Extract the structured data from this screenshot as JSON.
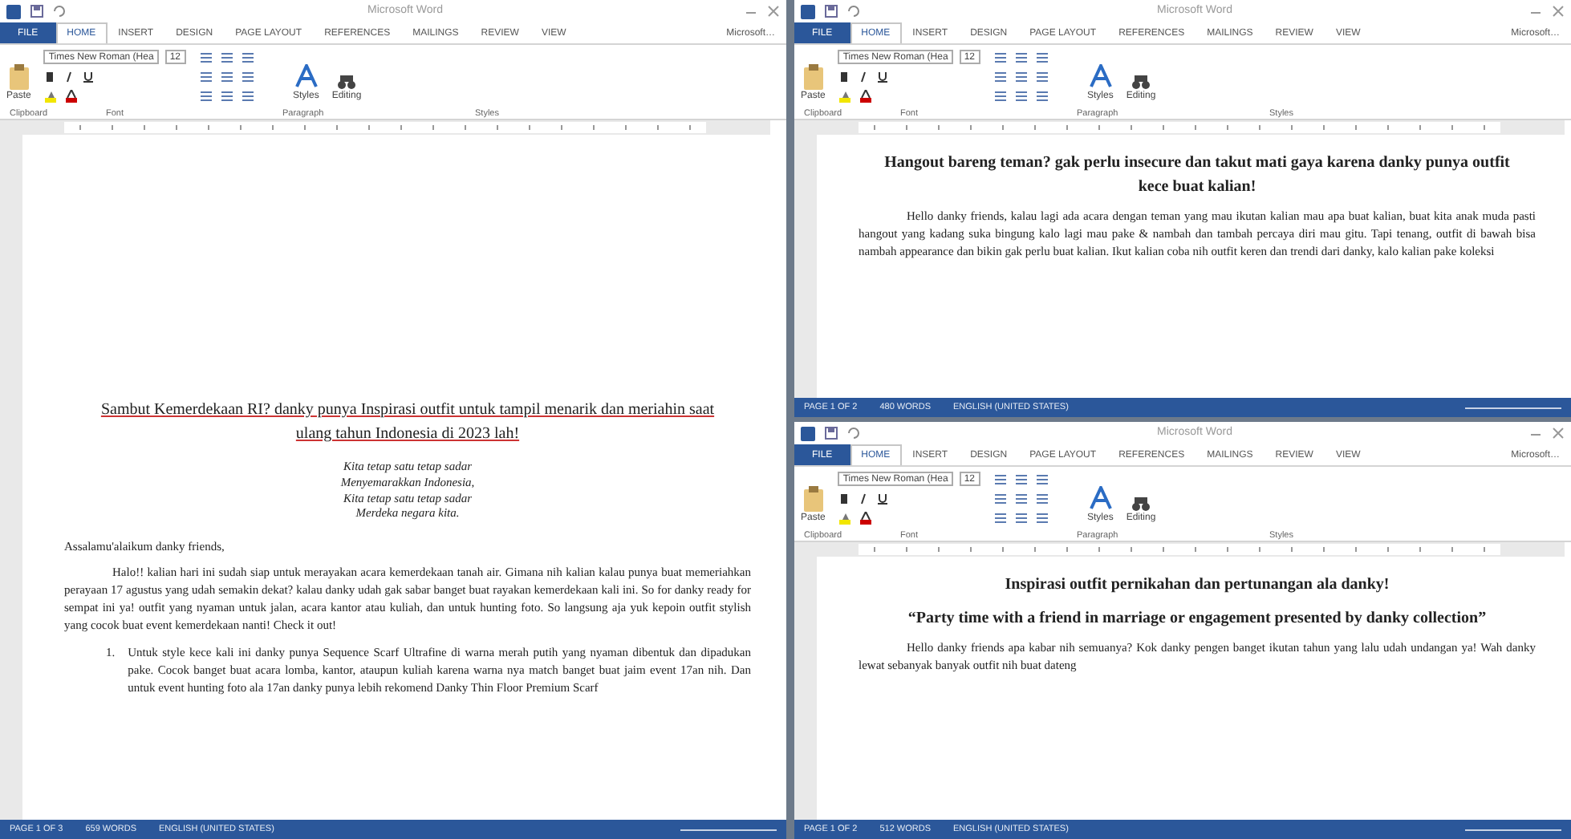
{
  "windows": [
    {
      "title": "Microsoft Word",
      "tabs": [
        {
          "label": "FILE",
          "kind": "file",
          "selected": false
        },
        {
          "label": "HOME",
          "kind": "tab",
          "selected": true
        },
        {
          "label": "INSERT",
          "kind": "tab",
          "selected": false
        },
        {
          "label": "DESIGN",
          "kind": "tab",
          "selected": false
        },
        {
          "label": "PAGE LAYOUT",
          "kind": "tab",
          "selected": false
        },
        {
          "label": "REFERENCES",
          "kind": "tab",
          "selected": false
        },
        {
          "label": "MAILINGS",
          "kind": "tab",
          "selected": false
        },
        {
          "label": "REVIEW",
          "kind": "tab",
          "selected": false
        },
        {
          "label": "VIEW",
          "kind": "tab",
          "selected": false
        },
        {
          "label": "Microsoft…",
          "kind": "account",
          "selected": false
        }
      ],
      "ribbon": {
        "font": "Times New Roman (Hea",
        "size": "12",
        "paste": "Paste",
        "styles": "Styles",
        "editing": "Editing",
        "groups": [
          "Clipboard",
          "Font",
          "Paragraph",
          "Styles"
        ]
      },
      "document": [
        {
          "kind": "heading",
          "text": "Sambut Kemerdekaan RI? danky punya Inspirasi outfit untuk tampil menarik dan meriahin saat ulang tahun Indonesia di 2023 lah!"
        },
        {
          "kind": "poem",
          "text": "Kita tetap satu tetap sadar"
        },
        {
          "kind": "poem",
          "text": "Menyemarakkan Indonesia,"
        },
        {
          "kind": "poem",
          "text": "Kita tetap satu tetap sadar"
        },
        {
          "kind": "poem",
          "text": "Merdeka negara kita."
        },
        {
          "kind": "greeting",
          "text": "Assalamu'alaikum danky friends,"
        },
        {
          "kind": "body",
          "text": "Halo!! kalian hari ini sudah siap untuk merayakan acara kemerdekaan tanah air. Gimana nih kalian kalau punya buat memeriahkan perayaan 17 agustus yang udah semakin dekat? kalau danky udah gak sabar banget buat rayakan kemerdekaan kali ini. So for danky ready for sempat ini ya! outfit yang nyaman untuk jalan, acara kantor atau kuliah, dan untuk hunting foto. So langsung aja yuk kepoin outfit stylish yang cocok buat event kemerdekaan nanti! Check it out!"
        },
        {
          "kind": "list",
          "number": "1.",
          "text": "Untuk style kece kali ini danky punya Sequence Scarf Ultrafine di warna merah putih yang nyaman dibentuk dan dipadukan pake. Cocok banget buat acara lomba, kantor, ataupun kuliah karena warna nya match banget buat jaim event 17an nih. Dan untuk event hunting foto ala 17an danky punya lebih rekomend Danky Thin Floor Premium Scarf"
        }
      ],
      "status": [
        "PAGE 1 OF 3",
        "659 WORDS",
        "ENGLISH (UNITED STATES)"
      ]
    },
    {
      "title": "Microsoft Word",
      "tabs": [
        {
          "label": "FILE",
          "kind": "file",
          "selected": false
        },
        {
          "label": "HOME",
          "kind": "tab",
          "selected": true
        },
        {
          "label": "INSERT",
          "kind": "tab",
          "selected": false
        },
        {
          "label": "DESIGN",
          "kind": "tab",
          "selected": false
        },
        {
          "label": "PAGE LAYOUT",
          "kind": "tab",
          "selected": false
        },
        {
          "label": "REFERENCES",
          "kind": "tab",
          "selected": false
        },
        {
          "label": "MAILINGS",
          "kind": "tab",
          "selected": false
        },
        {
          "label": "REVIEW",
          "kind": "tab",
          "selected": false
        },
        {
          "label": "VIEW",
          "kind": "tab",
          "selected": false
        },
        {
          "label": "Microsoft…",
          "kind": "account",
          "selected": false
        }
      ],
      "ribbon": {
        "font": "Times New Roman (Hea",
        "size": "12",
        "paste": "Paste",
        "styles": "Styles",
        "editing": "Editing",
        "groups": [
          "Clipboard",
          "Font",
          "Paragraph",
          "Styles"
        ]
      },
      "document": [
        {
          "kind": "title",
          "text": "Hangout bareng teman? gak perlu insecure dan takut mati gaya karena danky punya outfit kece buat kalian!"
        },
        {
          "kind": "body",
          "text": "Hello danky friends, kalau lagi ada acara dengan teman yang mau ikutan kalian mau apa buat kalian, buat kita anak muda pasti hangout yang kadang suka bingung kalo lagi mau pake & nambah dan tambah percaya diri mau gitu. Tapi tenang, outfit di bawah bisa nambah appearance dan bikin gak perlu buat kalian. Ikut kalian coba nih outfit keren dan trendi dari danky, kalo kalian pake koleksi"
        }
      ],
      "status": [
        "PAGE 1 OF 2",
        "480 WORDS",
        "ENGLISH (UNITED STATES)"
      ]
    },
    {
      "title": "Microsoft Word",
      "tabs": [
        {
          "label": "FILE",
          "kind": "file",
          "selected": false
        },
        {
          "label": "HOME",
          "kind": "tab",
          "selected": true
        },
        {
          "label": "INSERT",
          "kind": "tab",
          "selected": false
        },
        {
          "label": "DESIGN",
          "kind": "tab",
          "selected": false
        },
        {
          "label": "PAGE LAYOUT",
          "kind": "tab",
          "selected": false
        },
        {
          "label": "REFERENCES",
          "kind": "tab",
          "selected": false
        },
        {
          "label": "MAILINGS",
          "kind": "tab",
          "selected": false
        },
        {
          "label": "REVIEW",
          "kind": "tab",
          "selected": false
        },
        {
          "label": "VIEW",
          "kind": "tab",
          "selected": false
        },
        {
          "label": "Microsoft…",
          "kind": "account",
          "selected": false
        }
      ],
      "ribbon": {
        "font": "Times New Roman (Hea",
        "size": "12",
        "paste": "Paste",
        "styles": "Styles",
        "editing": "Editing",
        "groups": [
          "Clipboard",
          "Font",
          "Paragraph",
          "Styles"
        ]
      },
      "document": [
        {
          "kind": "title",
          "text": "Inspirasi outfit pernikahan dan pertunangan ala danky!"
        },
        {
          "kind": "quote",
          "text": "“Party time with a friend in marriage or engagement presented by danky collection”"
        },
        {
          "kind": "body",
          "text": "Hello danky friends apa kabar nih semuanya? Kok danky pengen banget ikutan tahun yang lalu udah undangan ya! Wah danky lewat sebanyak banyak outfit nih buat dateng"
        }
      ],
      "status": [
        "PAGE 1 OF 2",
        "512 WORDS",
        "ENGLISH (UNITED STATES)"
      ]
    }
  ]
}
